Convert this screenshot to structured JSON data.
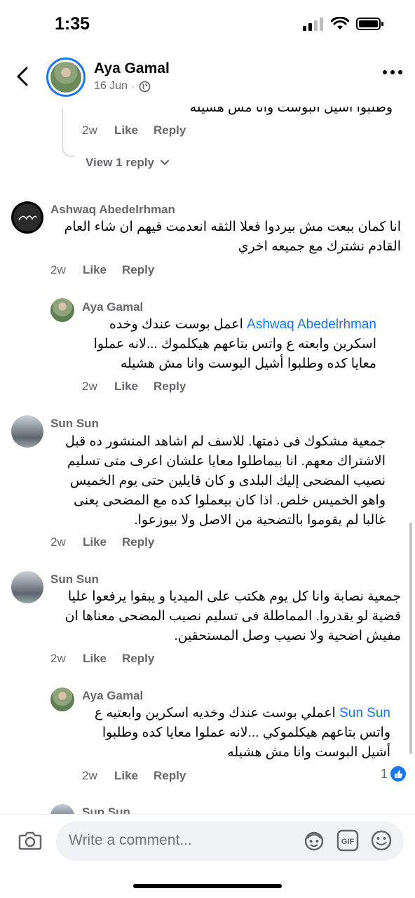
{
  "status": {
    "time": "1:35"
  },
  "header": {
    "name": "Aya Gamal",
    "date": "16 Jun"
  },
  "top_partial": {
    "text": "وطلبوا أشيل البوست وانا مش هشيله",
    "time": "2w",
    "like": "Like",
    "reply": "Reply",
    "view_replies": "View 1 reply"
  },
  "comments": [
    {
      "name": "Ashwaq Abedelrhman",
      "text": "انا كمان ببعت مش بيردوا فعلا الثقه انعدمت فيهم ان شاء العام القادم نشترك مع جميعه اخري",
      "time": "2w",
      "like": "Like",
      "reply": "Reply"
    },
    {
      "name": "Aya Gamal",
      "mention": "Ashwaq Abedelrhman",
      "text": "اعمل بوست عندك وخده اسكرين وابعته ع واتس بتاعهم هيكلموك ...لانه عملوا معايا كده وطلبوا أشيل البوست وانا مش هشيله",
      "time": "2w",
      "like": "Like",
      "reply": "Reply"
    },
    {
      "name": "Sun Sun",
      "text": "جمعية مشكوك فى ذمتها. للاسف لم اشاهد المنشور ده قبل الاشتراك معهم. انا بيماطلوا معايا علشان اعرف متى تسليم نصيب المضحى إليك البلدى و كان قايلين حتى يوم الخميس واهو الخميس خلص.  اذا كان بيعملوا كده مع المضحى يعنى غالبا لم يقوموا بالتضحية من الاصل ولا بيوزعوا.",
      "time": "2w",
      "like": "Like",
      "reply": "Reply"
    },
    {
      "name": "Sun Sun",
      "text": "جمعية نصابة وانا كل يوم هكتب على الميديا و يبقوا يرفعوا عليا قضية لو يقدروا. المماطلة فى تسليم نصيب المضحى معناها ان مفيش اضحية ولا نصيب وصل المستحقين.",
      "time": "2w",
      "like": "Like",
      "reply": "Reply"
    },
    {
      "name": "Aya Gamal",
      "mention": "Sun Sun",
      "text": "اعملي بوست عندك وخديه اسكرين وابعتيه ع واتس بتاعهم هيكلموكي ...لانه عملوا معايا كده وطلبوا أشيل البوست وانا مش هشيله",
      "time": "2w",
      "like": "Like",
      "reply": "Reply",
      "reactions": "1"
    },
    {
      "name": "Sun Sun"
    }
  ],
  "composer": {
    "placeholder": "Write a comment..."
  }
}
